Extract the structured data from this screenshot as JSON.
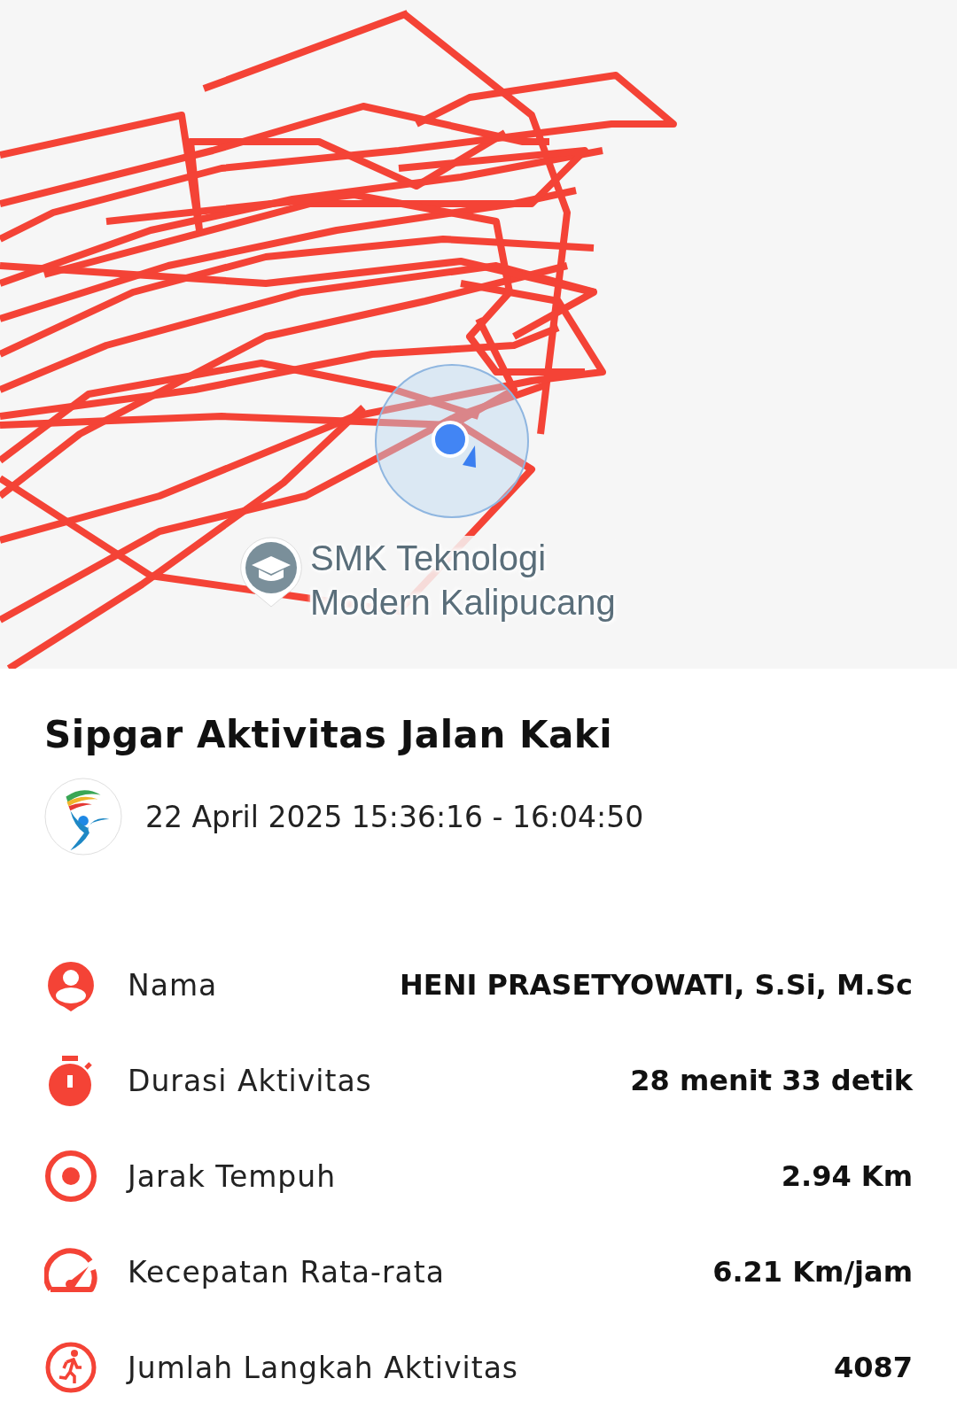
{
  "map": {
    "poi": {
      "label_lines": [
        "SMK Teknologi",
        "Modern Kalipucang"
      ]
    }
  },
  "title": "Sipgar Aktivitas Jalan Kaki",
  "session": {
    "datetime": "22 April 2025 15:36:16 - 16:04:50"
  },
  "stats": [
    {
      "kind": "person",
      "label": "Nama",
      "value": "HENI PRASETYOWATI, S.Si, M.Sc"
    },
    {
      "kind": "timer",
      "label": "Durasi Aktivitas",
      "value": "28 menit 33 detik"
    },
    {
      "kind": "target",
      "label": "Jarak Tempuh",
      "value": "2.94 Km"
    },
    {
      "kind": "speed",
      "label": "Kecepatan Rata-rata",
      "value": "6.21 Km/jam"
    },
    {
      "kind": "steps",
      "label": "Jumlah Langkah Aktivitas",
      "value": "4087"
    }
  ]
}
